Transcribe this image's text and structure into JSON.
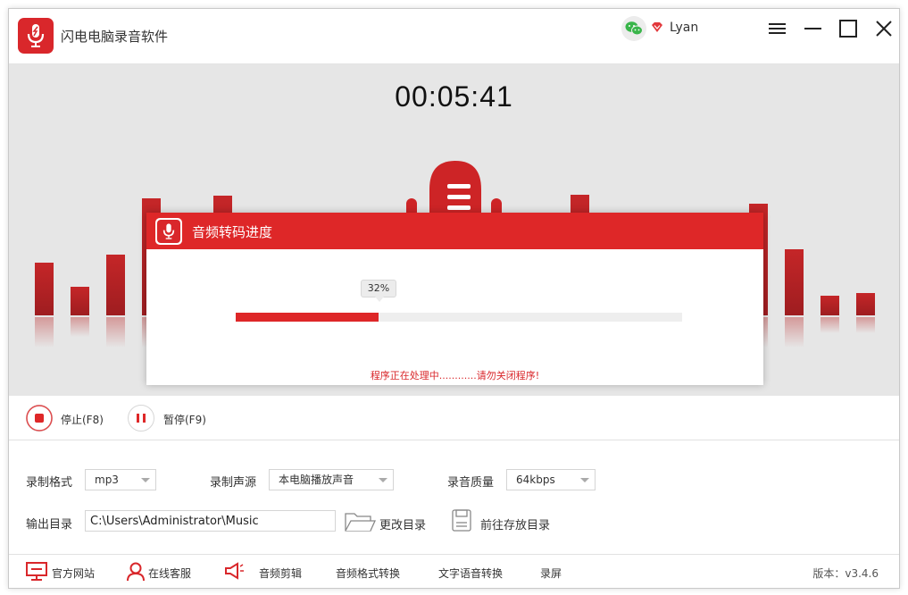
{
  "app": {
    "title": "闪电电脑录音软件"
  },
  "user": {
    "name": "Lyan"
  },
  "recorder": {
    "elapsed": "00:05:41"
  },
  "dialog": {
    "title": "音频转码进度",
    "progress_label": "32%",
    "progress_percent": 32,
    "message": "程序正在处理中............请勿关闭程序!"
  },
  "controls": {
    "stop_label": "停止(F8)",
    "pause_label": "暂停(F9)"
  },
  "settings": {
    "format_label": "录制格式",
    "format_value": "mp3",
    "source_label": "录制声源",
    "source_value": "本电脑播放声音",
    "quality_label": "录音质量",
    "quality_value": "64kbps",
    "output_label": "输出目录",
    "output_path": "C:\\Users\\Administrator\\Music",
    "change_dir_label": "更改目录",
    "open_dir_label": "前往存放目录"
  },
  "footer": {
    "official_site": "官方网站",
    "online_service": "在线客服",
    "audio_cut": "音频剪辑",
    "format_convert": "音频格式转换",
    "tts": "文字语音转换",
    "screen_record": "录屏",
    "version": "版本：v3.4.6"
  },
  "colors": {
    "brand_red": "#de2728",
    "bar_red": "#b62125"
  }
}
